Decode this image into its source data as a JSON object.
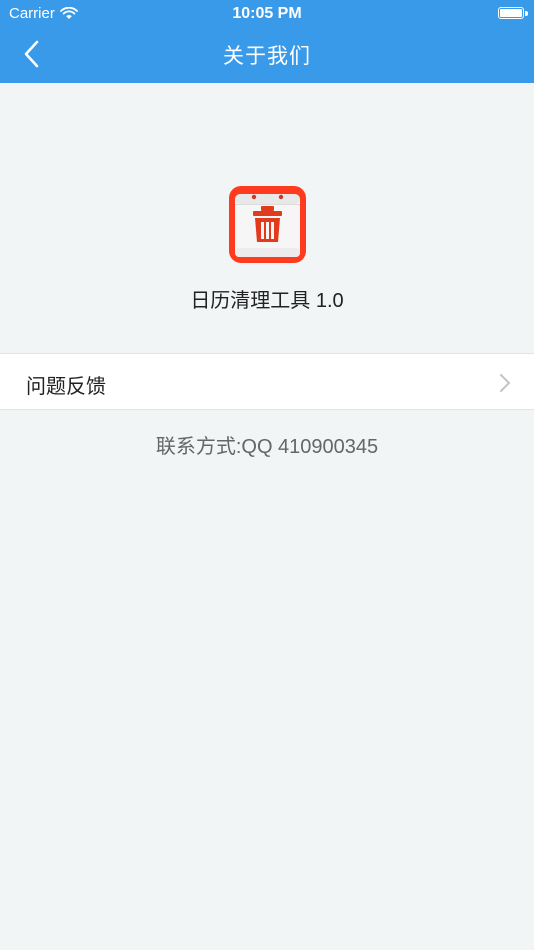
{
  "status_bar": {
    "carrier": "Carrier",
    "time": "10:05 PM",
    "wifi_icon": "wifi-icon",
    "battery_icon": "battery-icon"
  },
  "nav": {
    "title": "关于我们",
    "back_icon": "chevron-left-icon"
  },
  "app": {
    "icon": "calendar-trash-icon",
    "name": "日历清理工具 1.0"
  },
  "menu": {
    "feedback_label": "问题反馈",
    "chevron_icon": "chevron-right-icon"
  },
  "contact": {
    "text": "联系方式:QQ 410900345"
  },
  "colors": {
    "nav_background": "#3a9aea",
    "page_background": "#f1f5f5",
    "icon_red": "#ff3b1f"
  }
}
